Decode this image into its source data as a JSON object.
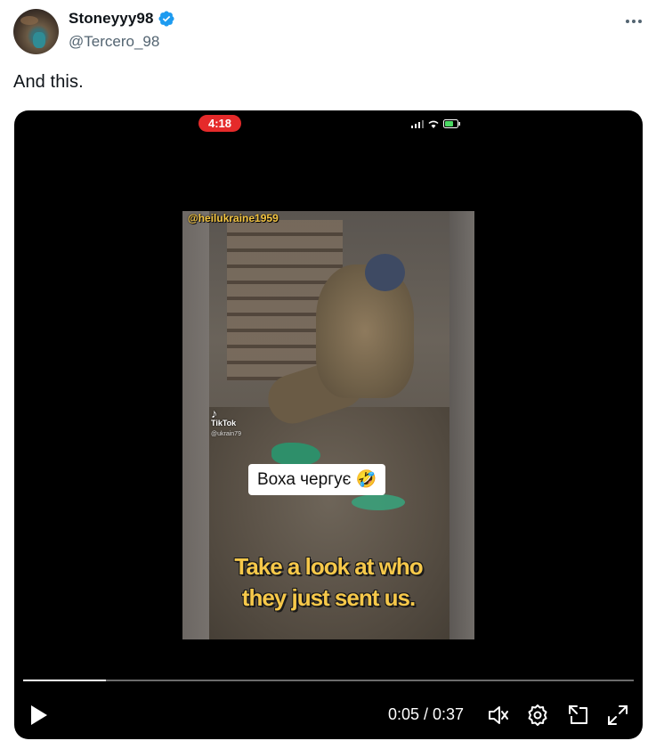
{
  "author": {
    "display_name": "Stoneyyy98",
    "handle": "@Tercero_98",
    "verified": true
  },
  "tweet": {
    "text": "And this."
  },
  "video": {
    "phone_clock": "4:18",
    "overlay_handle": "@heilukraine1959",
    "tiktok_label": "TikTok",
    "tiktok_user": "@ukrain79",
    "caption_box": "Воха чергує 🤣",
    "subtitle_line1": "Take a look at who",
    "subtitle_line2": "they just sent us.",
    "time_display": "0:05 / 0:37",
    "progress": 0.135
  },
  "colors": {
    "verified_badge": "#1d9bf0",
    "recording_pill": "#e52a2a",
    "subtitle_text": "#f6c84a",
    "handle_text": "#536471"
  },
  "icons": [
    "avatar",
    "verified-badge-icon",
    "more-options-icon",
    "play-icon",
    "mute-icon",
    "settings-icon",
    "pop-out-icon",
    "fullscreen-icon"
  ]
}
